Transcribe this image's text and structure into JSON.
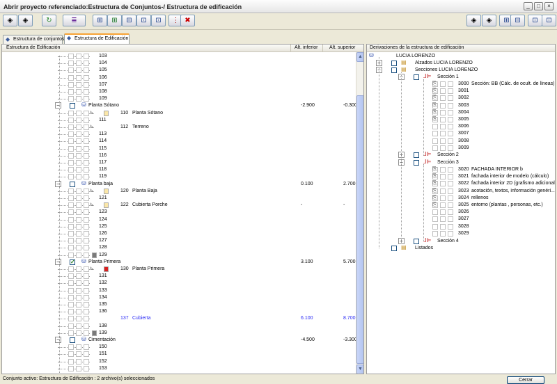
{
  "window": {
    "title": "Abrir proyecto referenciado:Estructura de Conjuntos-/ Estructura de edificación"
  },
  "toolbar": {
    "icons": [
      "tag-icon",
      "tags-icon",
      "refresh-icon",
      "filter-icon",
      "tree-add-icon",
      "tree-add-multi-icon",
      "tree-remove-icon",
      "tree-expand-icon",
      "tree-collapse-icon",
      "info-icon",
      "delete-icon",
      "tag-right-icon",
      "tags-right-icon",
      "tree-add-right-icon",
      "tree-remove-right-icon",
      "tree-expand-right-icon",
      "tree-collapse-right-icon"
    ]
  },
  "tabs": [
    {
      "label": "Estructura de conjuntos"
    },
    {
      "label": "Estructura de Edificación"
    }
  ],
  "left_panel": {
    "headers": {
      "name": "Estructura de Edificación",
      "low": "Alt. inferior",
      "high": "Alt. superior"
    },
    "rows": [
      {
        "type": "num",
        "num": "103"
      },
      {
        "type": "num",
        "num": "104"
      },
      {
        "type": "num",
        "num": "105"
      },
      {
        "type": "num",
        "num": "106"
      },
      {
        "type": "num",
        "num": "107"
      },
      {
        "type": "num",
        "num": "108"
      },
      {
        "type": "num",
        "num": "109"
      },
      {
        "type": "floor",
        "label": "Planta Sótano",
        "low": "-2.900",
        "high": "-0.300"
      },
      {
        "type": "item",
        "num": "110",
        "label": "Planta Sótano",
        "icon": "pale"
      },
      {
        "type": "num",
        "num": "111"
      },
      {
        "type": "item",
        "num": "112",
        "label": "Terreno",
        "icon": "ruler"
      },
      {
        "type": "num",
        "num": "113"
      },
      {
        "type": "num",
        "num": "114"
      },
      {
        "type": "num",
        "num": "115"
      },
      {
        "type": "num",
        "num": "116"
      },
      {
        "type": "num",
        "num": "117"
      },
      {
        "type": "num",
        "num": "118"
      },
      {
        "type": "num",
        "num": "119"
      },
      {
        "type": "floor",
        "label": "Planta baja",
        "low": "0.100",
        "high": "2.700"
      },
      {
        "type": "item",
        "num": "120",
        "label": "Planta Baja",
        "icon": "pale"
      },
      {
        "type": "num",
        "num": "121"
      },
      {
        "type": "item",
        "num": "122",
        "label": "Cubierta Porche",
        "icon": "pale",
        "low": "-",
        "high": "-"
      },
      {
        "type": "num",
        "num": "123"
      },
      {
        "type": "num",
        "num": "124"
      },
      {
        "type": "num",
        "num": "125"
      },
      {
        "type": "num",
        "num": "126"
      },
      {
        "type": "num",
        "num": "127"
      },
      {
        "type": "num",
        "num": "128"
      },
      {
        "type": "num",
        "num": "129",
        "icon": "gray"
      },
      {
        "type": "floor",
        "label": "Planta Primera",
        "low": "3.100",
        "high": "5.700",
        "checked": true
      },
      {
        "type": "item",
        "num": "130",
        "label": "Planta Primera",
        "icon": "red"
      },
      {
        "type": "num",
        "num": "131"
      },
      {
        "type": "num",
        "num": "132"
      },
      {
        "type": "num",
        "num": "133"
      },
      {
        "type": "num",
        "num": "134"
      },
      {
        "type": "num",
        "num": "135"
      },
      {
        "type": "num",
        "num": "136"
      },
      {
        "type": "item",
        "num": "137",
        "label": "Cubierta",
        "icon": "none",
        "low": "6.100",
        "high": "8.700",
        "blue": true
      },
      {
        "type": "num",
        "num": "138"
      },
      {
        "type": "num",
        "num": "139",
        "icon": "gray"
      },
      {
        "type": "floor",
        "label": "Cimentación",
        "low": "-4.500",
        "high": "-3.300"
      },
      {
        "type": "num",
        "num": "150"
      },
      {
        "type": "num",
        "num": "151"
      },
      {
        "type": "num",
        "num": "152"
      },
      {
        "type": "num",
        "num": "153"
      }
    ]
  },
  "right_panel": {
    "header": "Derivaciones de la estructura de edificación",
    "root": "LUCIA LORENZO",
    "alzados": "Alzados LUCIA LORENZO",
    "secciones": "Secciones LUCIA LORENZO",
    "seccion1": "Sección 1",
    "s1_items": [
      {
        "num": "3000",
        "label": "Sección: BB (Cálc. de ocult. de líneas)"
      },
      {
        "num": "3001",
        "label": ""
      },
      {
        "num": "3002",
        "label": ""
      },
      {
        "num": "3003",
        "label": ""
      },
      {
        "num": "3004",
        "label": ""
      },
      {
        "num": "3005",
        "label": ""
      },
      {
        "num": "3006",
        "label": ""
      },
      {
        "num": "3007",
        "label": ""
      },
      {
        "num": "3008",
        "label": ""
      },
      {
        "num": "3009",
        "label": ""
      }
    ],
    "seccion2": "Sección 2",
    "seccion3": "Sección 3",
    "s3_items": [
      {
        "num": "3020",
        "label": "FACHADA INTERIOR b"
      },
      {
        "num": "3021",
        "label": "fachada interior de modelo (cálculo)"
      },
      {
        "num": "3022",
        "label": "fachada interior 2D (grafismo adicional)"
      },
      {
        "num": "3023",
        "label": "acotación, textos, información genéri..."
      },
      {
        "num": "3024",
        "label": "rellenos"
      },
      {
        "num": "3025",
        "label": "entorno (plantas , personas, etc.)"
      },
      {
        "num": "3026",
        "label": ""
      },
      {
        "num": "3027",
        "label": ""
      },
      {
        "num": "3028",
        "label": ""
      },
      {
        "num": "3029",
        "label": ""
      }
    ],
    "seccion4": "Sección 4",
    "listados": "Listados"
  },
  "status": {
    "text": "Conjunto activo: Estructura de Edificación : 2 archivo(s) seleccionados"
  },
  "close_button": {
    "label": "Cerrar"
  }
}
